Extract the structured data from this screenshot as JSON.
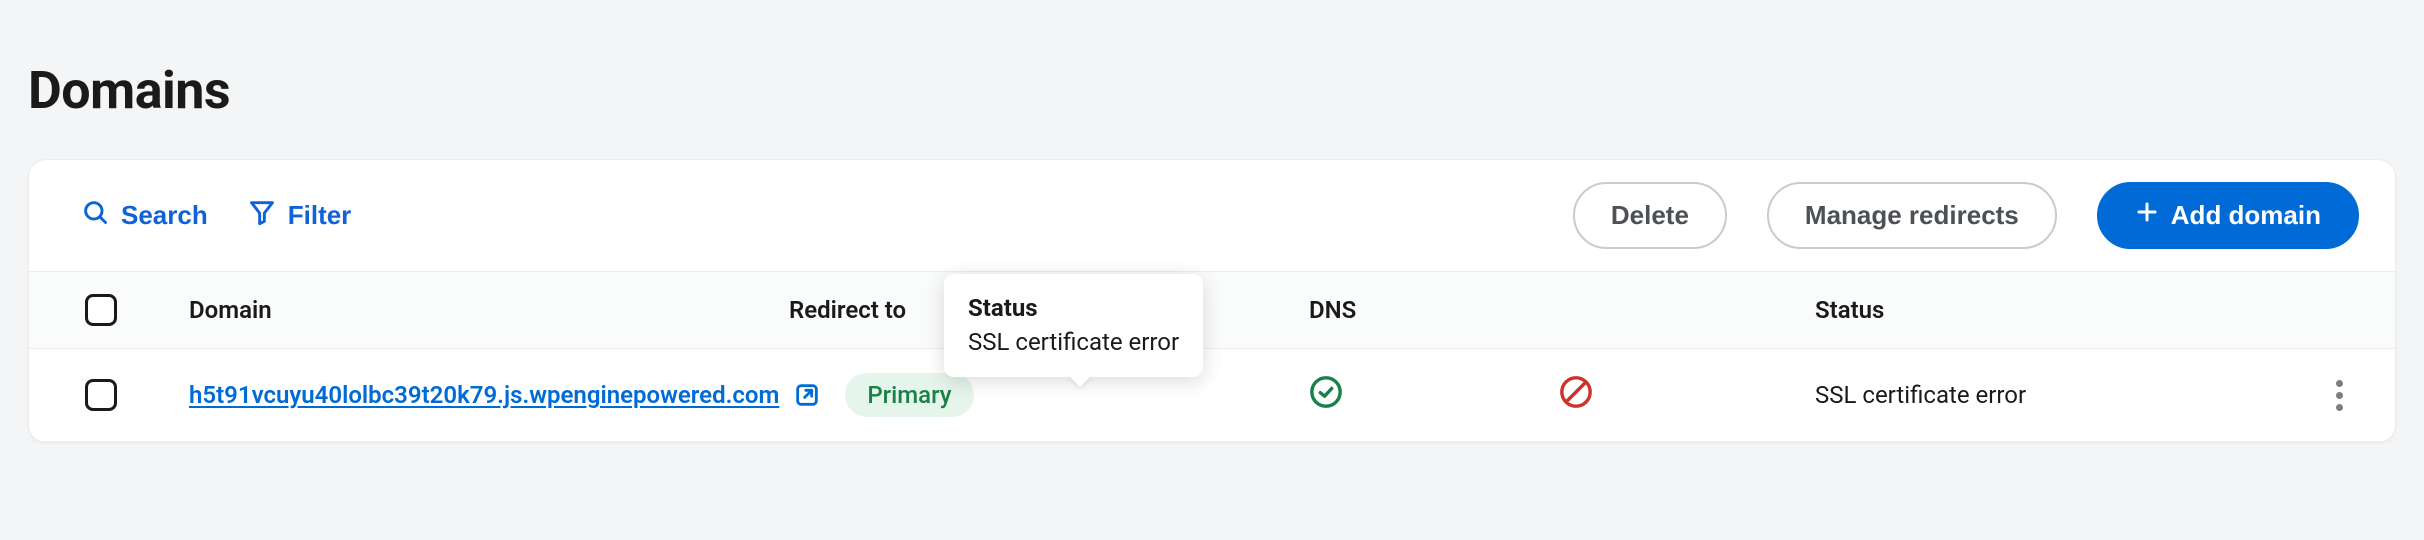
{
  "page": {
    "title": "Domains"
  },
  "toolbar": {
    "search_label": "Search",
    "filter_label": "Filter",
    "delete_label": "Delete",
    "manage_redirects_label": "Manage redirects",
    "add_domain_label": "Add domain"
  },
  "table": {
    "headers": {
      "domain": "Domain",
      "redirect_to": "Redirect to",
      "dns": "DNS",
      "status": "Status"
    },
    "rows": [
      {
        "domain": "h5t91vcuyu40lolbc39t20k79.js.wpenginepowered.com",
        "badge": "Primary",
        "redirect_to": "",
        "dns_ok": true,
        "ssl_ok": false,
        "status_text": "SSL certificate error"
      }
    ]
  },
  "tooltip": {
    "title": "Status",
    "body": "SSL certificate error"
  },
  "colors": {
    "primary_blue": "#006bd6",
    "link_blue": "#0f62d7",
    "success_green": "#198049",
    "error_red": "#d0312d",
    "badge_bg": "#e6f5ec"
  }
}
